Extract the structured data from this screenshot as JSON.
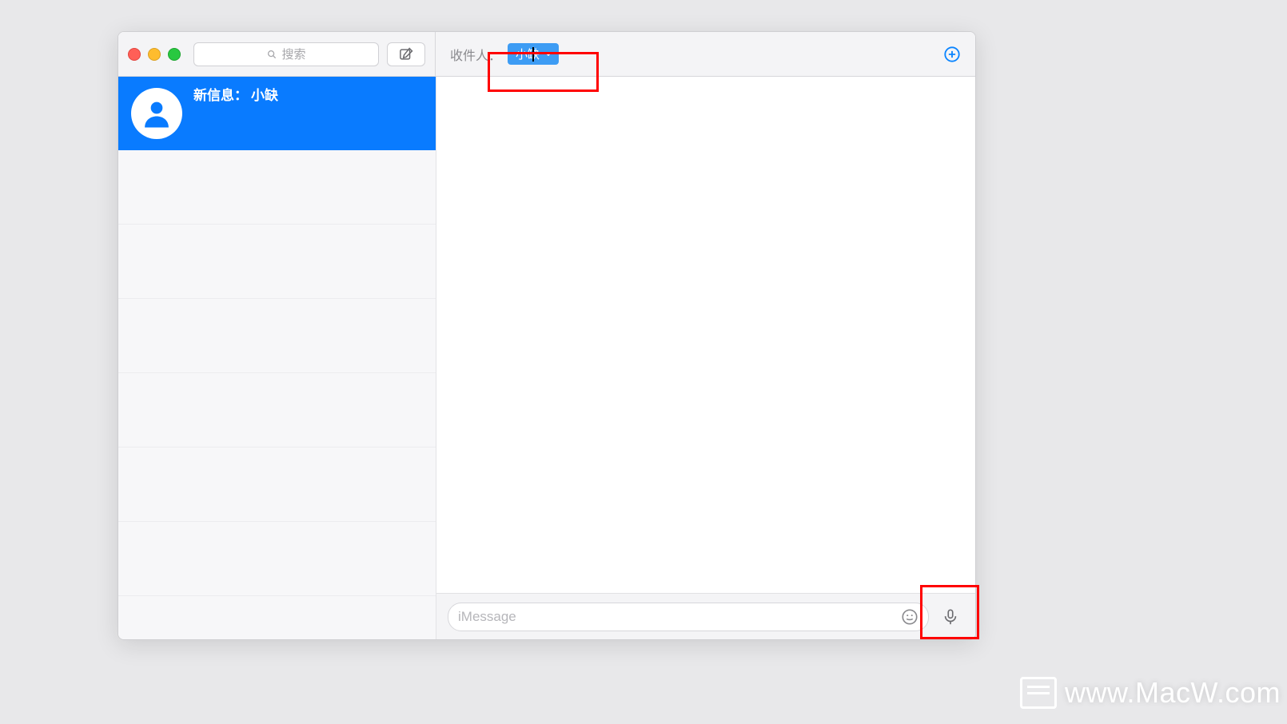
{
  "sidebar": {
    "search_placeholder": "搜索",
    "conversation": {
      "title_prefix": "新信息：",
      "name": "小缺"
    }
  },
  "header": {
    "recipient_label": "收件人：",
    "recipient_chip_name": "小缺"
  },
  "input": {
    "placeholder": "iMessage"
  },
  "watermark": "www.MacW.com",
  "colors": {
    "selection_blue": "#097bff",
    "chip_blue": "#3d9cf4",
    "accent_blue": "#0a84ff"
  }
}
